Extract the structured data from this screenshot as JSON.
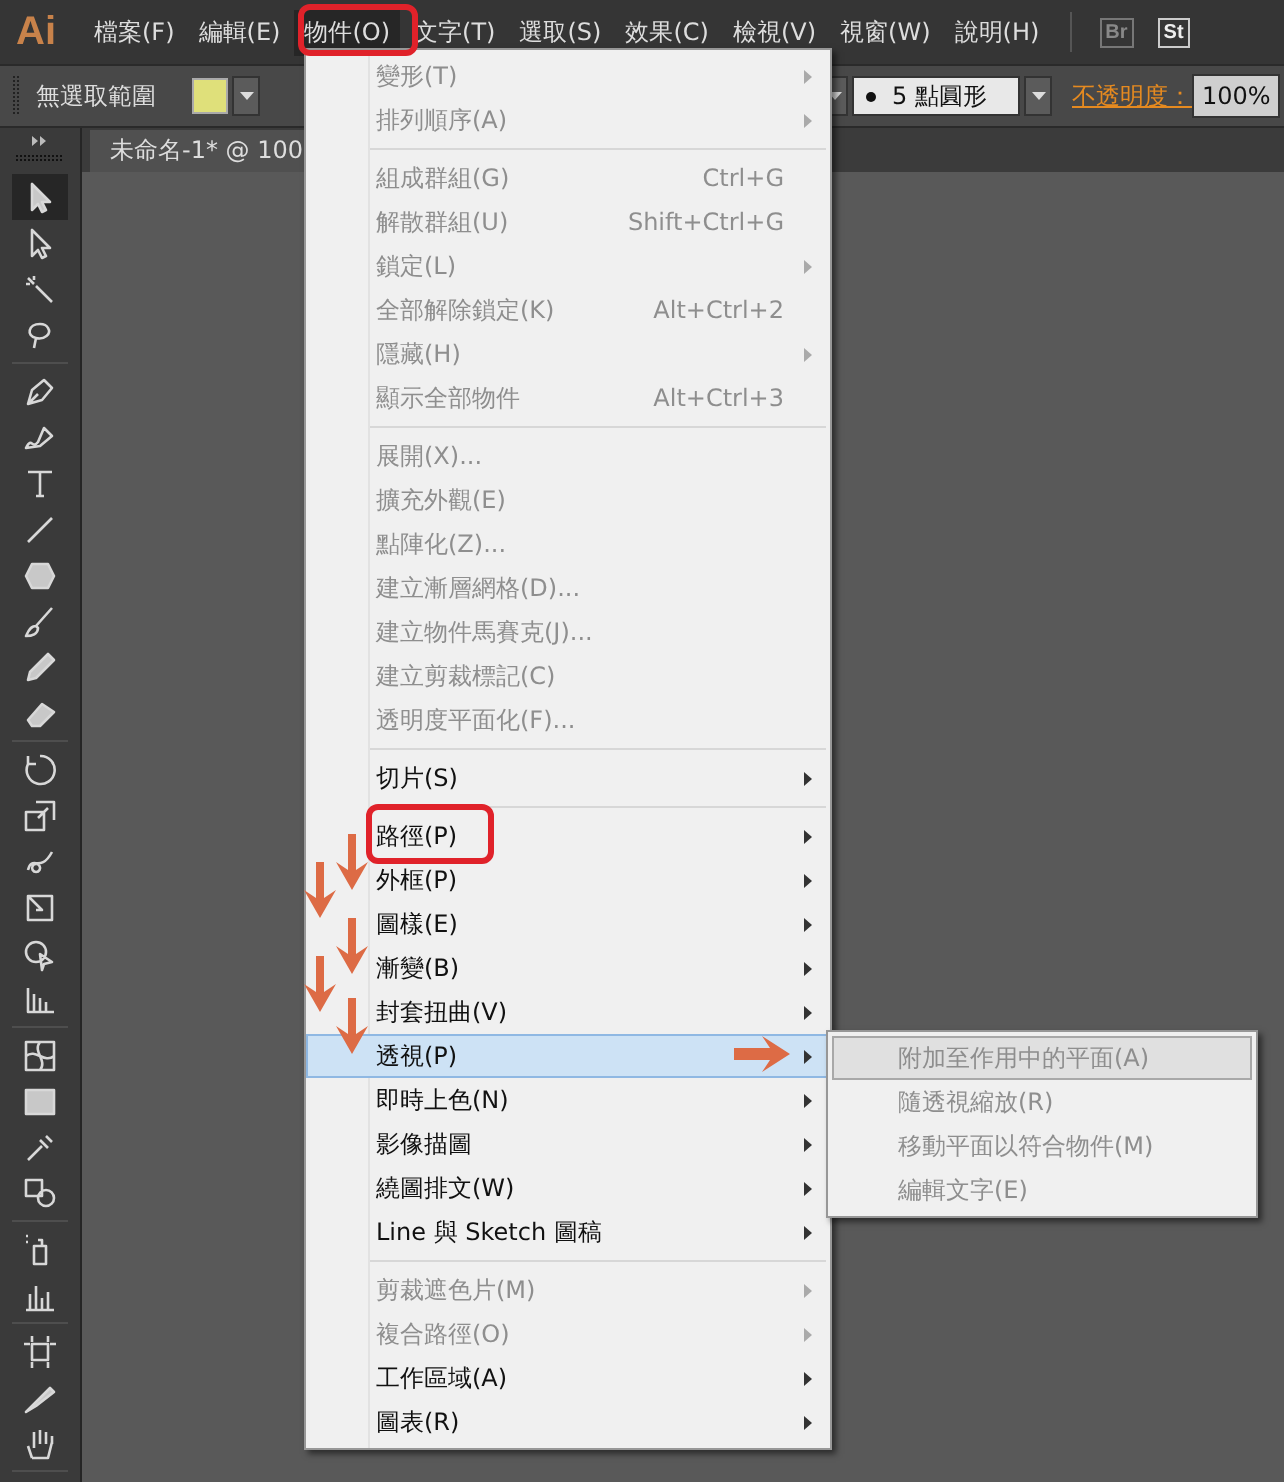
{
  "menubar": {
    "logo": "Ai",
    "menus": [
      {
        "label": "檔案(F)",
        "selected": false
      },
      {
        "label": "編輯(E)",
        "selected": false
      },
      {
        "label": "物件(O)",
        "selected": true
      },
      {
        "label": "文字(T)",
        "selected": false
      },
      {
        "label": "選取(S)",
        "selected": false
      },
      {
        "label": "效果(C)",
        "selected": false
      },
      {
        "label": "檢視(V)",
        "selected": false
      },
      {
        "label": "視窗(W)",
        "selected": false
      },
      {
        "label": "說明(H)",
        "selected": false
      }
    ],
    "apps": [
      "Br",
      "St"
    ]
  },
  "control_bar": {
    "selection": "無選取範圍",
    "brush": "5 點圓形",
    "opacity_label": "不透明度：",
    "opacity": "100%"
  },
  "document_tab": {
    "title": "未命名-1* @ 100"
  },
  "tool_groups": [
    [
      {
        "kind": "selection",
        "selected": true
      },
      {
        "kind": "direct-selection",
        "selected": false
      },
      {
        "kind": "magic-wand",
        "selected": false
      },
      {
        "kind": "lasso",
        "selected": false
      }
    ],
    [
      {
        "kind": "pen",
        "selected": false
      },
      {
        "kind": "curvature",
        "selected": false
      },
      {
        "kind": "type",
        "selected": false
      },
      {
        "kind": "line",
        "selected": false
      },
      {
        "kind": "polygon",
        "selected": false
      },
      {
        "kind": "brush",
        "selected": false
      },
      {
        "kind": "pencil",
        "selected": false
      },
      {
        "kind": "eraser",
        "selected": false
      }
    ],
    [
      {
        "kind": "rotate",
        "selected": false
      },
      {
        "kind": "scale",
        "selected": false
      },
      {
        "kind": "warp",
        "selected": false
      },
      {
        "kind": "free-transform",
        "selected": false
      },
      {
        "kind": "shape-builder",
        "selected": false
      },
      {
        "kind": "perspective",
        "selected": false
      }
    ],
    [
      {
        "kind": "mesh",
        "selected": false
      },
      {
        "kind": "gradient",
        "selected": false
      },
      {
        "kind": "eyedropper",
        "selected": false
      },
      {
        "kind": "blend",
        "selected": false
      }
    ],
    [
      {
        "kind": "sprayer",
        "selected": false
      },
      {
        "kind": "graph",
        "selected": false
      }
    ],
    [
      {
        "kind": "artboard",
        "selected": false
      },
      {
        "kind": "knife",
        "selected": false
      },
      {
        "kind": "hand",
        "selected": false
      }
    ]
  ],
  "object_menu": {
    "groups": [
      [
        {
          "label": "變形(T)",
          "submenu": true,
          "disabled": true,
          "selected": false
        },
        {
          "label": "排列順序(A)",
          "submenu": true,
          "disabled": true,
          "selected": false
        }
      ],
      [
        {
          "label": "組成群組(G)",
          "shortcut": "Ctrl+G",
          "submenu": false,
          "disabled": true,
          "selected": false
        },
        {
          "label": "解散群組(U)",
          "shortcut": "Shift+Ctrl+G",
          "submenu": false,
          "disabled": true,
          "selected": false
        },
        {
          "label": "鎖定(L)",
          "submenu": true,
          "disabled": true,
          "selected": false
        },
        {
          "label": "全部解除鎖定(K)",
          "shortcut": "Alt+Ctrl+2",
          "submenu": false,
          "disabled": true,
          "selected": false
        },
        {
          "label": "隱藏(H)",
          "submenu": true,
          "disabled": true,
          "selected": false
        },
        {
          "label": "顯示全部物件",
          "shortcut": "Alt+Ctrl+3",
          "submenu": false,
          "disabled": true,
          "selected": false
        }
      ],
      [
        {
          "label": "展開(X)...",
          "submenu": false,
          "disabled": true,
          "selected": false
        },
        {
          "label": "擴充外觀(E)",
          "submenu": false,
          "disabled": true,
          "selected": false
        },
        {
          "label": "點陣化(Z)...",
          "submenu": false,
          "disabled": true,
          "selected": false
        },
        {
          "label": "建立漸層網格(D)...",
          "submenu": false,
          "disabled": true,
          "selected": false
        },
        {
          "label": "建立物件馬賽克(J)...",
          "submenu": false,
          "disabled": true,
          "selected": false
        },
        {
          "label": "建立剪裁標記(C)",
          "submenu": false,
          "disabled": true,
          "selected": false
        },
        {
          "label": "透明度平面化(F)...",
          "submenu": false,
          "disabled": true,
          "selected": false
        }
      ],
      [
        {
          "label": "切片(S)",
          "submenu": true,
          "disabled": false,
          "selected": false
        }
      ],
      [
        {
          "label": "路徑(P)",
          "submenu": true,
          "disabled": false,
          "selected": false
        },
        {
          "label": "外框(P)",
          "submenu": true,
          "disabled": false,
          "selected": false
        },
        {
          "label": "圖樣(E)",
          "submenu": true,
          "disabled": false,
          "selected": false
        },
        {
          "label": "漸變(B)",
          "submenu": true,
          "disabled": false,
          "selected": false
        },
        {
          "label": "封套扭曲(V)",
          "submenu": true,
          "disabled": false,
          "selected": false
        },
        {
          "label": "透視(P)",
          "submenu": true,
          "disabled": false,
          "selected": true
        },
        {
          "label": "即時上色(N)",
          "submenu": true,
          "disabled": false,
          "selected": false
        },
        {
          "label": "影像描圖",
          "submenu": true,
          "disabled": false,
          "selected": false
        },
        {
          "label": "繞圖排文(W)",
          "submenu": true,
          "disabled": false,
          "selected": false
        },
        {
          "label": "Line 與 Sketch 圖稿",
          "submenu": true,
          "disabled": false,
          "selected": false
        }
      ],
      [
        {
          "label": "剪裁遮色片(M)",
          "submenu": true,
          "disabled": true,
          "selected": false
        },
        {
          "label": "複合路徑(O)",
          "submenu": true,
          "disabled": true,
          "selected": false
        },
        {
          "label": "工作區域(A)",
          "submenu": true,
          "disabled": false,
          "selected": false
        },
        {
          "label": "圖表(R)",
          "submenu": true,
          "disabled": false,
          "selected": false
        }
      ]
    ]
  },
  "perspective_submenu": {
    "items": [
      {
        "label": "附加至作用中的平面(A)",
        "disabled": true,
        "selected": true
      },
      {
        "label": "隨透視縮放(R)",
        "disabled": true,
        "selected": false
      },
      {
        "label": "移動平面以符合物件(M)",
        "disabled": true,
        "selected": false
      },
      {
        "label": "編輯文字(E)",
        "disabled": true,
        "selected": false
      }
    ]
  }
}
